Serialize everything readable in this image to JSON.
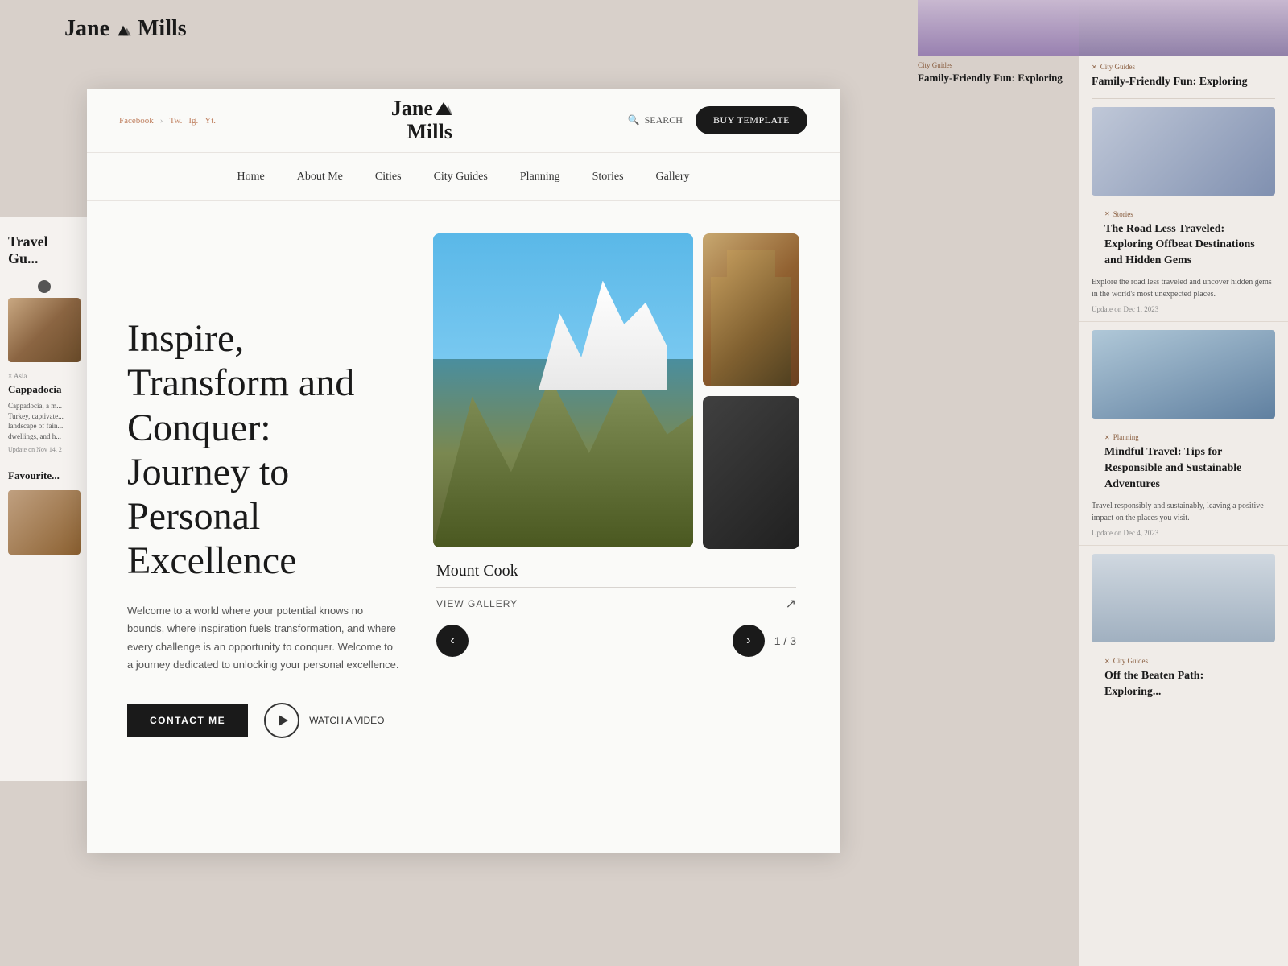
{
  "background": {
    "color": "#d8d0ca"
  },
  "bg_logo": {
    "line1": "Jane",
    "line2": "Mills"
  },
  "left_panel": {
    "travel_guides_title": "Travel Gu...",
    "asia_tag": "× Asia",
    "place_name": "Cappadocia",
    "place_desc": "Cappadocia, a m... Turkey, captivate... landscape of fain... dwellings, and h...",
    "update_date": "Update on Nov 14, 2",
    "favourites_title": "Favourite..."
  },
  "right_panel": {
    "top_tag": "City Guides",
    "top_title": "Family-Friendly Fun: Exploring",
    "article1": {
      "tag": "Stories",
      "title": "The Road Less Traveled: Exploring Offbeat Destinations and Hidden Gems",
      "desc": "Explore the road less traveled and uncover hidden gems in the world's most unexpected places.",
      "date": "Update on Dec 1, 2023"
    },
    "article2": {
      "tag": "Planning",
      "title": "Mindful Travel: Tips for Responsible and Sustainable Adventures",
      "desc": "Travel responsibly and sustainably, leaving a positive impact on the places you visit.",
      "date": "Update on Dec 4, 2023"
    },
    "article3": {
      "tag": "City Guides",
      "title": "Off the Beaten Path: Exploring..."
    }
  },
  "header": {
    "social_links": [
      "Facebook",
      "Tw.",
      "Ig.",
      "Yt."
    ],
    "logo_line1": "Jane",
    "logo_line2": "Mills",
    "search_label": "SEARCH",
    "buy_label": "BUY TEMPLATE"
  },
  "nav": {
    "items": [
      {
        "label": "Home",
        "href": "#"
      },
      {
        "label": "About Me",
        "href": "#"
      },
      {
        "label": "Cities",
        "href": "#"
      },
      {
        "label": "City Guides",
        "href": "#"
      },
      {
        "label": "Planning",
        "href": "#"
      },
      {
        "label": "Stories",
        "href": "#"
      },
      {
        "label": "Gallery",
        "href": "#"
      }
    ]
  },
  "hero": {
    "title": "Inspire, Transform and Conquer: Journey to Personal Excellence",
    "description": "Welcome to a world where your potential knows no bounds, where inspiration fuels transformation, and where every challenge is an opportunity to conquer. Welcome to a journey dedicated to unlocking your personal excellence.",
    "contact_label": "CONTACT ME",
    "watch_label": "WATCH A VIDEO"
  },
  "gallery": {
    "place_name": "Mount Cook",
    "view_gallery_label": "VIEW GALLERY",
    "counter": "1 / 3",
    "prev_label": "‹",
    "next_label": "›"
  }
}
